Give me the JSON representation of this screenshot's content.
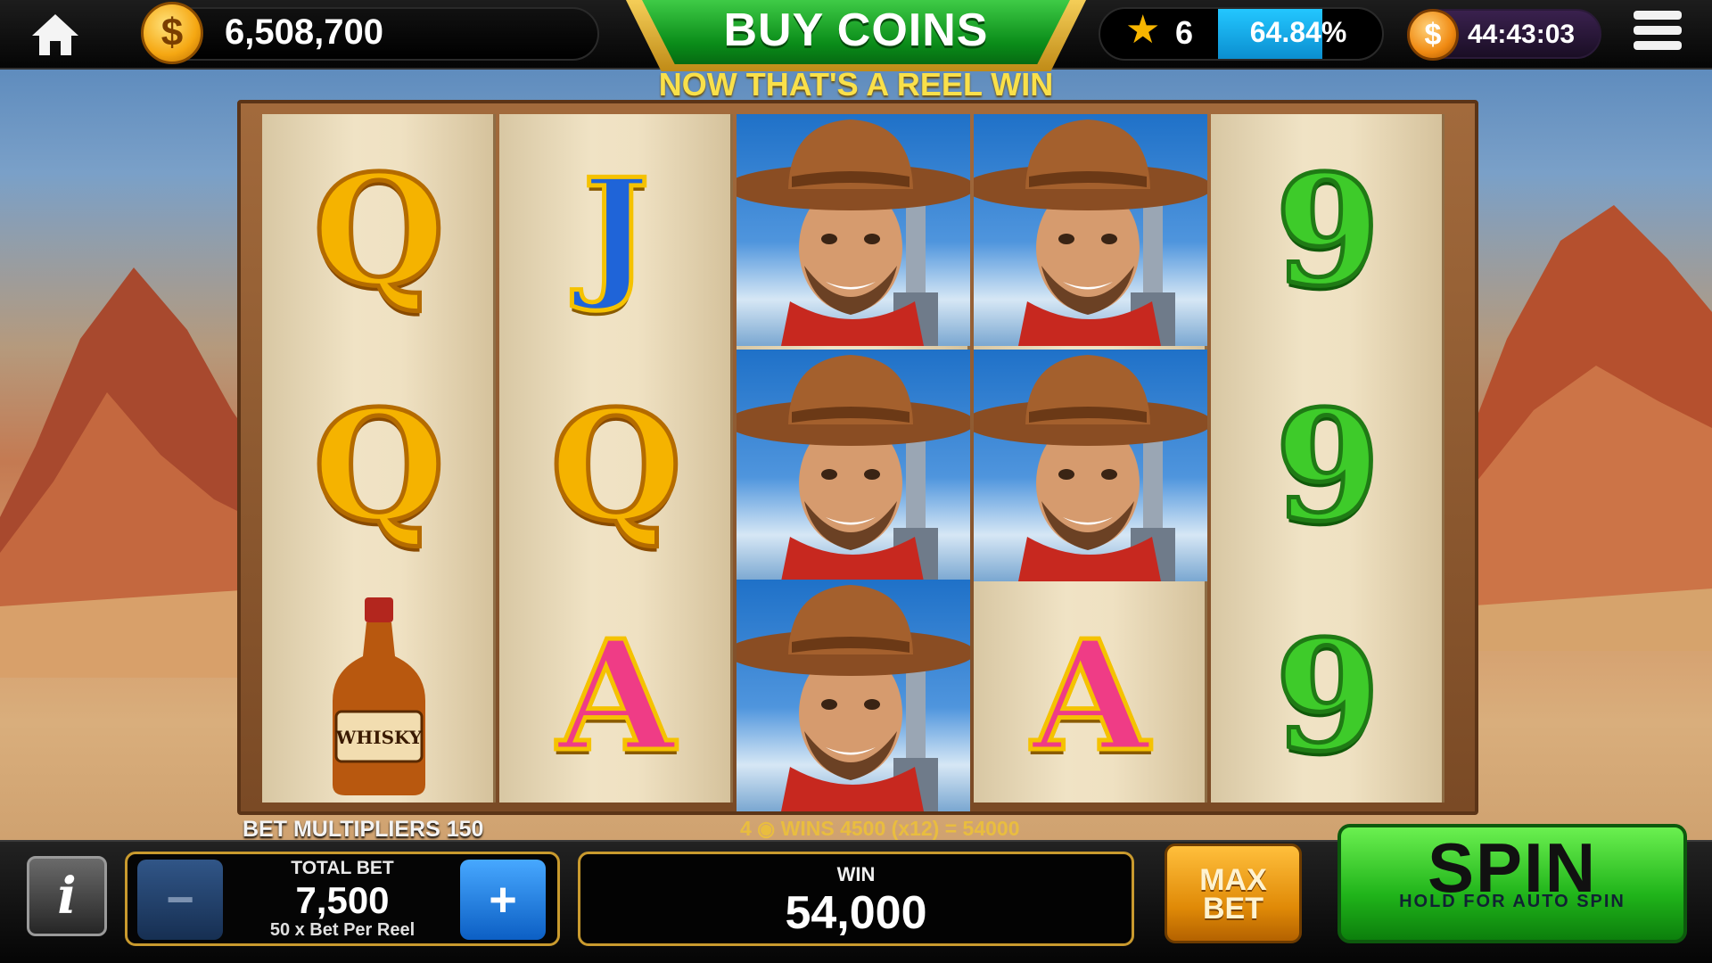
{
  "topbar": {
    "coin_balance": "6,508,700",
    "buy_coins_label": "BUY COINS",
    "level": "6",
    "xp_percent": "64.84%",
    "xp_fraction": 0.6484,
    "timer": "44:43:03"
  },
  "headline": "NOW THAT'S A REEL WIN",
  "reels": [
    [
      "Q",
      "Q",
      "WHISKY"
    ],
    [
      "J",
      "Q",
      "A"
    ],
    [
      "COWBOY",
      "COWBOY",
      "COWBOY"
    ],
    [
      "COWBOY",
      "COWBOY",
      "A"
    ],
    [
      "9",
      "9",
      "9"
    ]
  ],
  "whisky_label": "WHISKY",
  "info": {
    "bet_multipliers": "BET MULTIPLIERS 150",
    "win_line": "4   ◉   WINS   4500 (x12) = 54000"
  },
  "bet": {
    "label": "TOTAL BET",
    "value": "7,500",
    "sub": "50 x Bet Per Reel",
    "minus": "−",
    "plus": "+"
  },
  "win": {
    "label": "WIN",
    "value": "54,000"
  },
  "buttons": {
    "info": "i",
    "max_bet_1": "MAX",
    "max_bet_2": "BET",
    "spin": "SPIN",
    "spin_sub": "HOLD FOR AUTO SPIN"
  },
  "colors": {
    "buy_green": "#0a8c19",
    "xp_blue": "#23c7ff",
    "gold": "#c99a2e",
    "spin_green": "#20b41a"
  },
  "icons": [
    "home-icon",
    "coin-icon",
    "star-icon",
    "timer-coin-icon",
    "menu-icon",
    "info-icon"
  ]
}
